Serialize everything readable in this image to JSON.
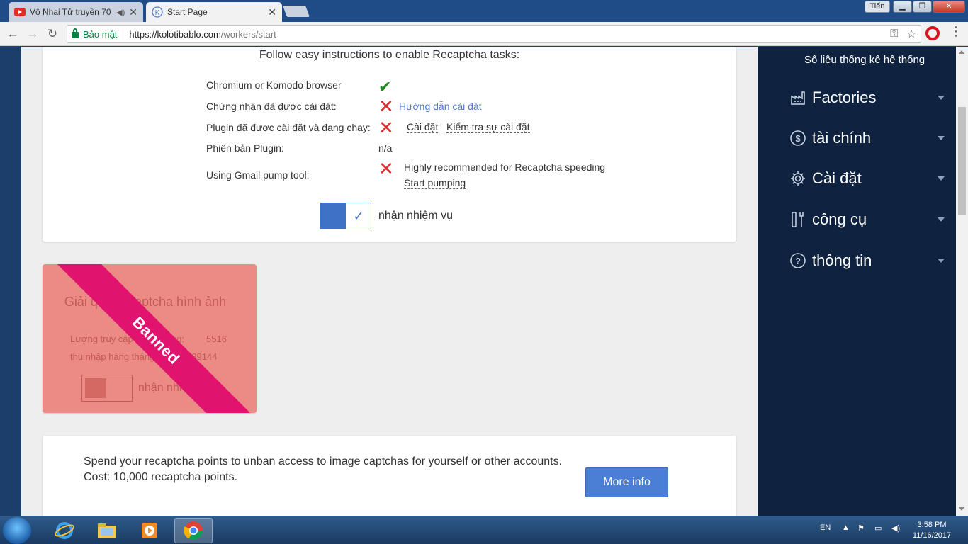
{
  "browser": {
    "tabs": [
      {
        "title": "Vô Nhai Tử truyền 70",
        "active": false
      },
      {
        "title": "Start Page",
        "active": true
      }
    ],
    "user_button": "Tiến",
    "secure_label": "Bảo mật",
    "url_host": "https://kolotibablo.com",
    "url_path": "/workers/start"
  },
  "recaptcha_card": {
    "heading": "Follow easy instructions to enable Recaptcha tasks:",
    "rows": [
      {
        "label": "Chromium or Komodo browser"
      },
      {
        "label": "Chứng nhận đã được cài đặt:",
        "link": "Hướng dẫn cài đặt"
      },
      {
        "label": "Plugin đã được cài đặt và đang chạy:",
        "link1": "Cài đặt",
        "link2": "Kiểm tra sự cài đặt"
      },
      {
        "label": "Phiên bản Plugin:",
        "value": "n/a"
      },
      {
        "label": "Using Gmail pump tool:",
        "note": "Highly recommended for Recaptcha speeding",
        "link": "Start pumping"
      }
    ],
    "toggle_label": "nhận nhiệm vụ",
    "toggle_checked": true
  },
  "image_card": {
    "title": "Giải quyết Captcha hình ảnh",
    "line1_label": "Lượng truy cập hàng tháng:",
    "line1_value": "5516",
    "line2_label": "thu nhập hàng tháng:",
    "line2_value": "139144",
    "toggle_label": "nhận nhiệm vụ",
    "ribbon": "Banned",
    "colors": {
      "ribbon": "#e0136e",
      "card": "#ec8a85"
    }
  },
  "unban_card": {
    "text_line1": "Spend your recaptcha points to unban access to image captchas for yourself or other accounts.",
    "text_line2": "Cost: 10,000 recaptcha points.",
    "button": "More info"
  },
  "sidebar": {
    "title": "Số liệu thống kê hệ thống",
    "items": [
      {
        "label": "Factories",
        "icon": "factory-icon"
      },
      {
        "label": "tài chính",
        "icon": "dollar-icon"
      },
      {
        "label": "Cài đặt",
        "icon": "gear-icon"
      },
      {
        "label": "công cụ",
        "icon": "tools-icon"
      },
      {
        "label": "thông tin",
        "icon": "help-icon"
      }
    ]
  },
  "taskbar": {
    "lang": "EN",
    "time": "3:58 PM",
    "date": "11/16/2017"
  }
}
